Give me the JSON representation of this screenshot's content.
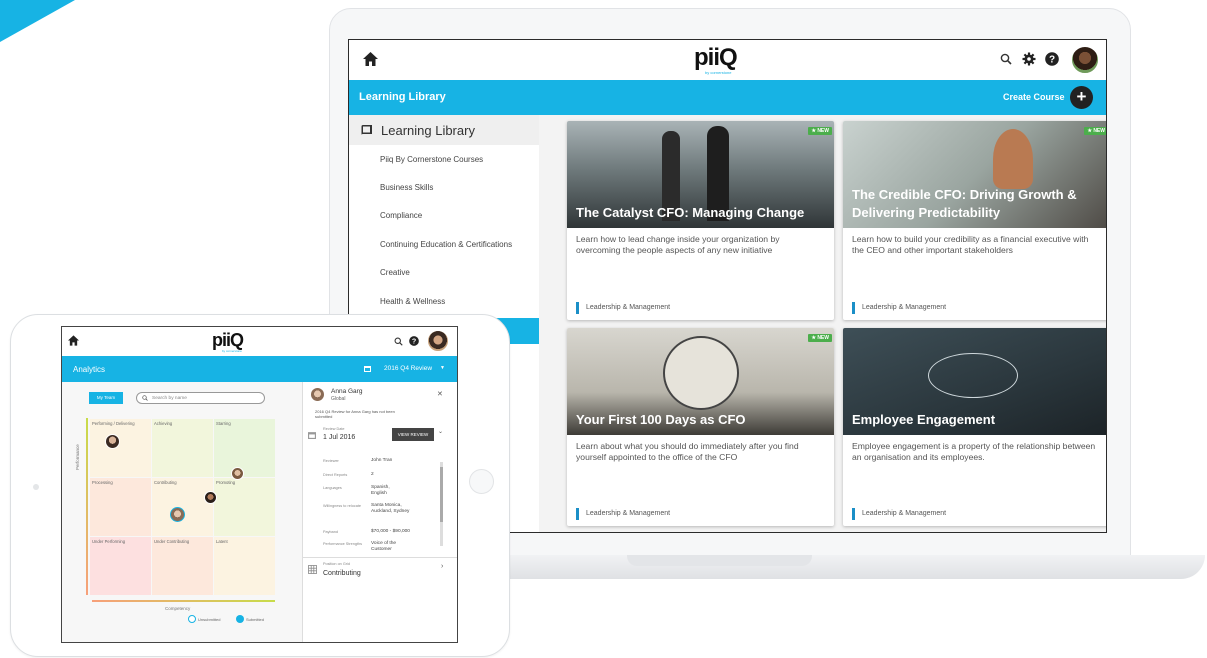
{
  "colors": {
    "accent": "#17b3e4",
    "new_badge": "#4cae4c",
    "tag_bar": "#1b8fc7"
  },
  "laptop": {
    "logo": "piiQ",
    "logo_sub": "by cornerstone",
    "section_title": "Learning Library",
    "create_label": "Create Course",
    "sidebar": {
      "header": "Learning Library",
      "items": [
        "Piiq By Cornerstone Courses",
        "Business Skills",
        "Compliance",
        "Continuing Education & Certifications",
        "Creative",
        "Health & Wellness"
      ]
    },
    "badge_new": "★ NEW",
    "cards": [
      {
        "title": "The Catalyst CFO: Managing Change",
        "description": "Learn how to lead change inside your organization by overcoming the people aspects of any new initiative",
        "tag": "Leadership & Management"
      },
      {
        "title": "The Credible CFO: Driving Growth & Delivering Predictability",
        "description": "Learn how to build your credibility as a financial executive with the CEO and other important stakeholders",
        "tag": "Leadership & Management"
      },
      {
        "title": "Your First 100 Days as CFO",
        "description": "Learn about what you should do immediately after you find yourself appointed to the office of the CFO",
        "tag": "Leadership & Management"
      },
      {
        "title": "Employee Engagement",
        "description": "Employee engagement is a property of the relationship between an organisation and its employees.",
        "tag": "Leadership & Management"
      }
    ]
  },
  "tablet": {
    "logo": "piiQ",
    "logo_sub": "by cornerstone",
    "section_title": "Analytics",
    "review_select": "2016 Q4 Review",
    "my_team": "My Team",
    "search_placeholder": "Search by name",
    "y_axis": "Performance",
    "x_axis": "Competency",
    "grid": [
      "Performing / Delivering",
      "Achieving",
      "Starring",
      "Processing",
      "Contributing",
      "Promoting",
      "Under Performing",
      "Under Contributing",
      "Latent"
    ],
    "legend": {
      "unsubmitted": "Unsubmitted",
      "submitted": "Submitted"
    },
    "panel": {
      "name": "Anna Garg",
      "region": "Global",
      "notice": "2016 Q4 Review for Anna Garg has not been submitted",
      "review_date_label": "Review Date",
      "review_date": "1 Jul 2016",
      "view_review": "VIEW REVIEW",
      "fields": [
        {
          "label": "Reviewer",
          "value": "John Tran"
        },
        {
          "label": "Direct Reports",
          "value": "2"
        },
        {
          "label": "Languages",
          "value": "Spanish, English"
        },
        {
          "label": "Willingness to relocate",
          "value": "Santa Monica, Auckland, Sydney"
        },
        {
          "label": "Payband",
          "value": "$70,000 - $90,000"
        },
        {
          "label": "Performance Strengths",
          "value": "Voice of the Customer"
        }
      ],
      "position_label": "Position on Grid",
      "position": "Contributing"
    }
  }
}
